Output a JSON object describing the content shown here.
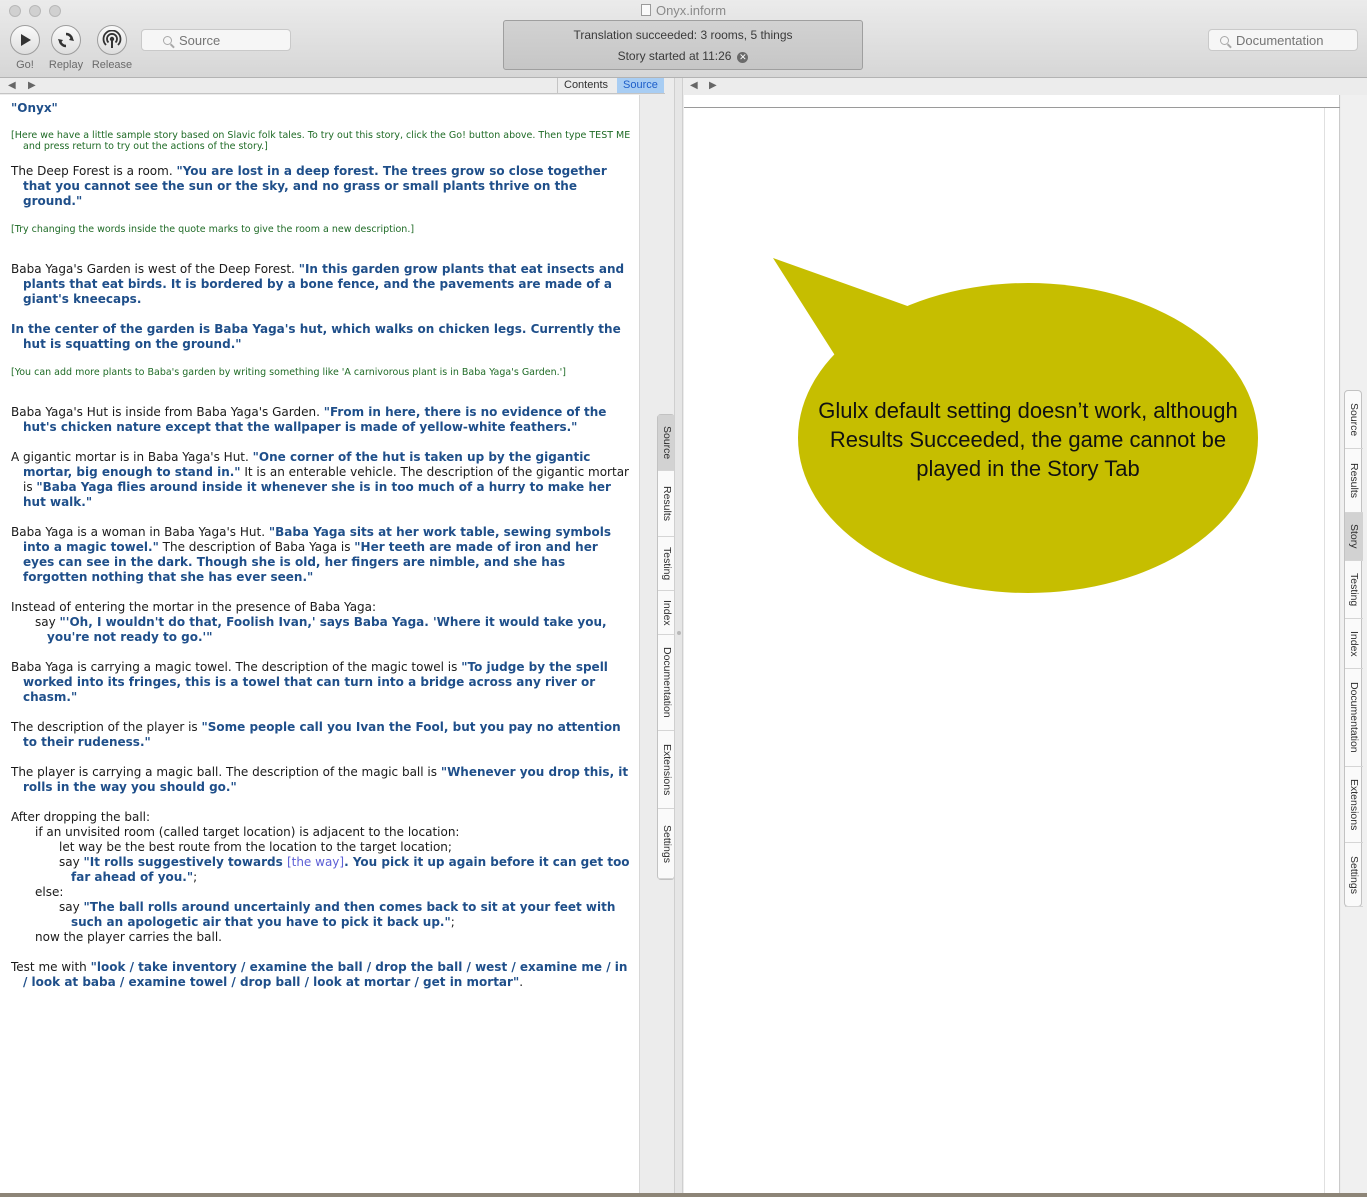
{
  "window": {
    "title": "Onyx.inform"
  },
  "toolbar": {
    "go_label": "Go!",
    "replay_label": "Replay",
    "release_label": "Release",
    "source_search_placeholder": "Source",
    "documentation_search_placeholder": "Documentation"
  },
  "status": {
    "line1": "Translation succeeded: 3 rooms, 5 things",
    "line2": "Story started at 11:26",
    "close_glyph": "✕"
  },
  "left_nav": {
    "back": "◀",
    "forward": "▶",
    "tab_contents": "Contents",
    "tab_source": "Source"
  },
  "right_nav": {
    "back": "◀",
    "forward": "▶"
  },
  "source": {
    "title": "\"Onyx\"",
    "intro_comment": "[Here we have a little sample story based on Slavic folk tales. To try out this story, click the Go! button above. Then type TEST ME and press return to try out the actions of the story.]",
    "deep_forest_plain": "The Deep Forest is a room. ",
    "deep_forest_quote": "\"You are lost in a deep forest. The trees grow so close together that you cannot see the sun or the sky, and no grass or small plants thrive on the ground.\"",
    "try_comment": "[Try changing the words inside the quote marks to give the room a new description.]",
    "garden_plain": "Baba Yaga's Garden is west of the Deep Forest. ",
    "garden_quote": "\"In this garden grow plants that eat insects and plants that eat birds. It is bordered by a bone fence, and the pavements are made of a giant's kneecaps.",
    "garden_quote2": "In the center of the garden is Baba Yaga's hut, which walks on chicken legs. Currently the hut is squatting on the ground.\"",
    "plants_comment": "[You can add more plants to Baba's garden by writing something like 'A carnivorous plant is in Baba Yaga's Garden.']",
    "hut_plain": "Baba Yaga's Hut is inside from Baba Yaga's Garden. ",
    "hut_quote": "\"From in here, there is no evidence of the hut's chicken nature except that the wallpaper is made of yellow-white feathers.\"",
    "mortar_plain1": "A gigantic mortar is in Baba Yaga's Hut. ",
    "mortar_quote1": "\"One corner of the hut is taken up by the gigantic mortar, big enough to stand in.\"",
    "mortar_plain2": " It is an enterable vehicle. The description of the gigantic mortar is ",
    "mortar_quote2": "\"Baba Yaga flies around inside it whenever she is in too much of a hurry to make her hut walk.\"",
    "baba_plain1": "Baba Yaga is a woman in Baba Yaga's Hut. ",
    "baba_quote1": "\"Baba Yaga sits at her work table, sewing symbols into a magic towel.\"",
    "baba_plain2": " The description of Baba Yaga is ",
    "baba_quote2": "\"Her teeth are made of iron and her eyes can see in the dark. Though she is old, her fingers are nimble, and she has forgotten nothing that she has ever seen.\"",
    "instead_line": "Instead of entering the mortar in the presence of Baba Yaga:",
    "instead_say_plain": "say ",
    "instead_say_quote": "\"'Oh, I wouldn't do that, Foolish Ivan,' says Baba Yaga. 'Where it would take you, you're not ready to go.'\"",
    "towel_plain": "Baba Yaga is carrying a magic towel. The description of the magic towel is ",
    "towel_quote": "\"To judge by the spell worked into its fringes, this is a towel that can turn into a bridge across any river or chasm.\"",
    "player_plain": "The description of the player is ",
    "player_quote": "\"Some people call you Ivan the Fool, but you pay no attention to their rudeness.\"",
    "ball_plain": "The player is carrying a magic ball. The description of the magic ball is ",
    "ball_quote": "\"Whenever you drop this, it rolls in the way you should go.\"",
    "after_line": "After dropping the ball:",
    "if_line": "if an unvisited room (called target location) is adjacent to the location:",
    "let_line": "let way be the best route from the location to the target location;",
    "say1_plain": "say ",
    "say1_quote_a": "\"It rolls suggestively towards ",
    "say1_sub": "[the way]",
    "say1_quote_b": ". You pick it up again before it can get too far ahead of you.\"",
    "say1_end": ";",
    "else_line": "else:",
    "say2_plain": "say ",
    "say2_quote": "\"The ball rolls around uncertainly and then comes back to sit at your feet with such an apologetic air that you have to pick it back up.\"",
    "say2_end": ";",
    "now_line": "now the player carries the ball.",
    "test_plain": "Test me with ",
    "test_quote": "\"look / take inventory / examine the ball / drop the ball / west / examine me / in / look at baba / examine towel / drop ball / look at mortar / get in mortar\"",
    "test_end": "."
  },
  "left_vtabs": [
    "Source",
    "Results",
    "Testing",
    "Index",
    "Documentation",
    "Extensions",
    "Settings"
  ],
  "right_vtabs": [
    "Source",
    "Results",
    "Story",
    "Testing",
    "Index",
    "Documentation",
    "Extensions",
    "Settings"
  ],
  "annotation": {
    "text": "Glulx default setting doesn’t work, although Results Succeeded, the game cannot be played in the Story Tab",
    "fill_color": "#c6be00"
  },
  "colors": {
    "quote_text": "#1f4f8a",
    "comment_text": "#1f6b26",
    "substitution_text": "#5c5fd6",
    "selected_tab": "#a8cdf3"
  }
}
